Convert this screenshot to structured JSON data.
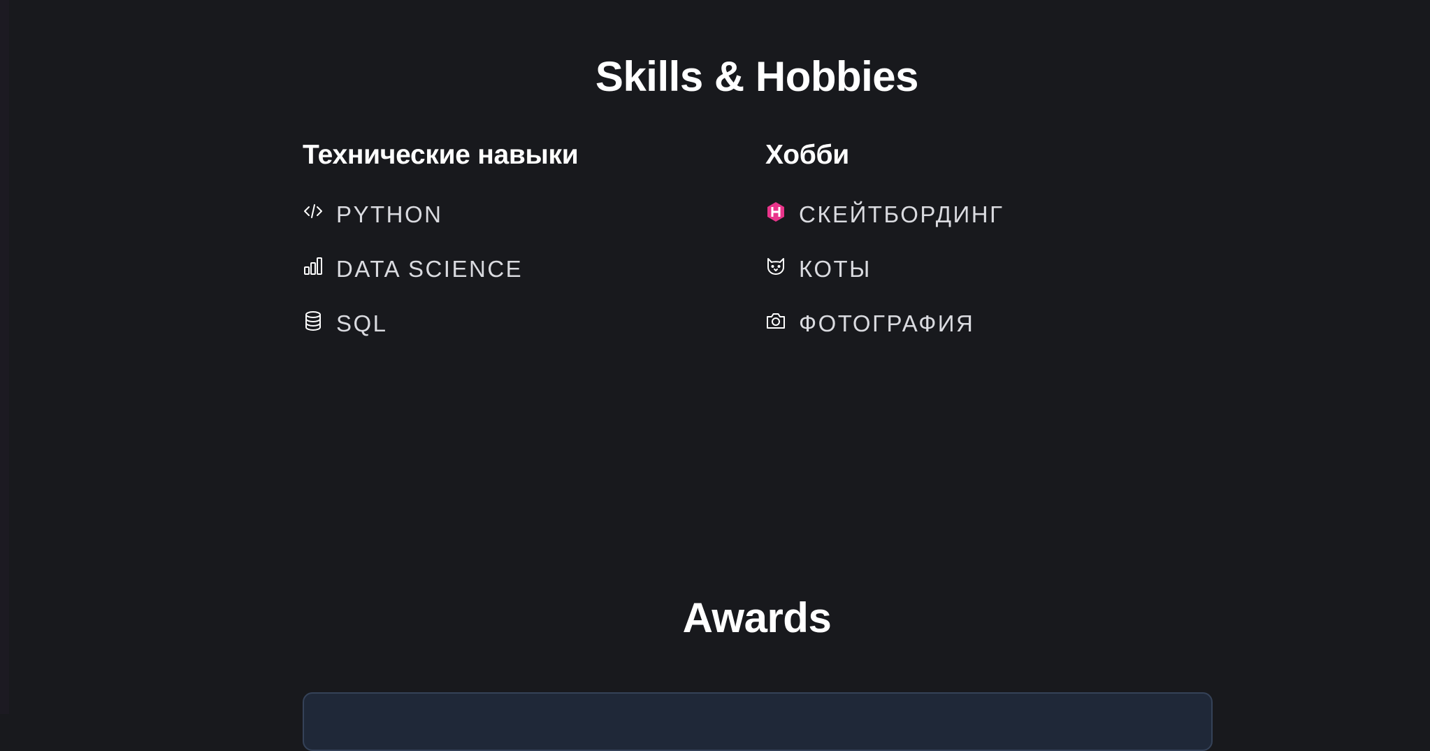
{
  "skills_section": {
    "title": "Skills & Hobbies",
    "technical": {
      "title": "Технические навыки",
      "items": [
        {
          "label": "PYTHON",
          "icon": "code-icon"
        },
        {
          "label": "DATA SCIENCE",
          "icon": "bar-chart-icon"
        },
        {
          "label": "SQL",
          "icon": "database-icon"
        }
      ]
    },
    "hobbies": {
      "title": "Хобби",
      "items": [
        {
          "label": "СКЕЙТБОРДИНГ",
          "icon": "hexagon-h-icon"
        },
        {
          "label": "КОТЫ",
          "icon": "cat-icon"
        },
        {
          "label": "ФОТОГРАФИЯ",
          "icon": "camera-icon"
        }
      ]
    }
  },
  "awards_section": {
    "title": "Awards"
  },
  "colors": {
    "background": "#18191d",
    "heading": "#ffffff",
    "item_text": "#dadbe0",
    "accent_pink": "#e8348a",
    "card_background": "#1f2838",
    "card_border": "#354258"
  }
}
